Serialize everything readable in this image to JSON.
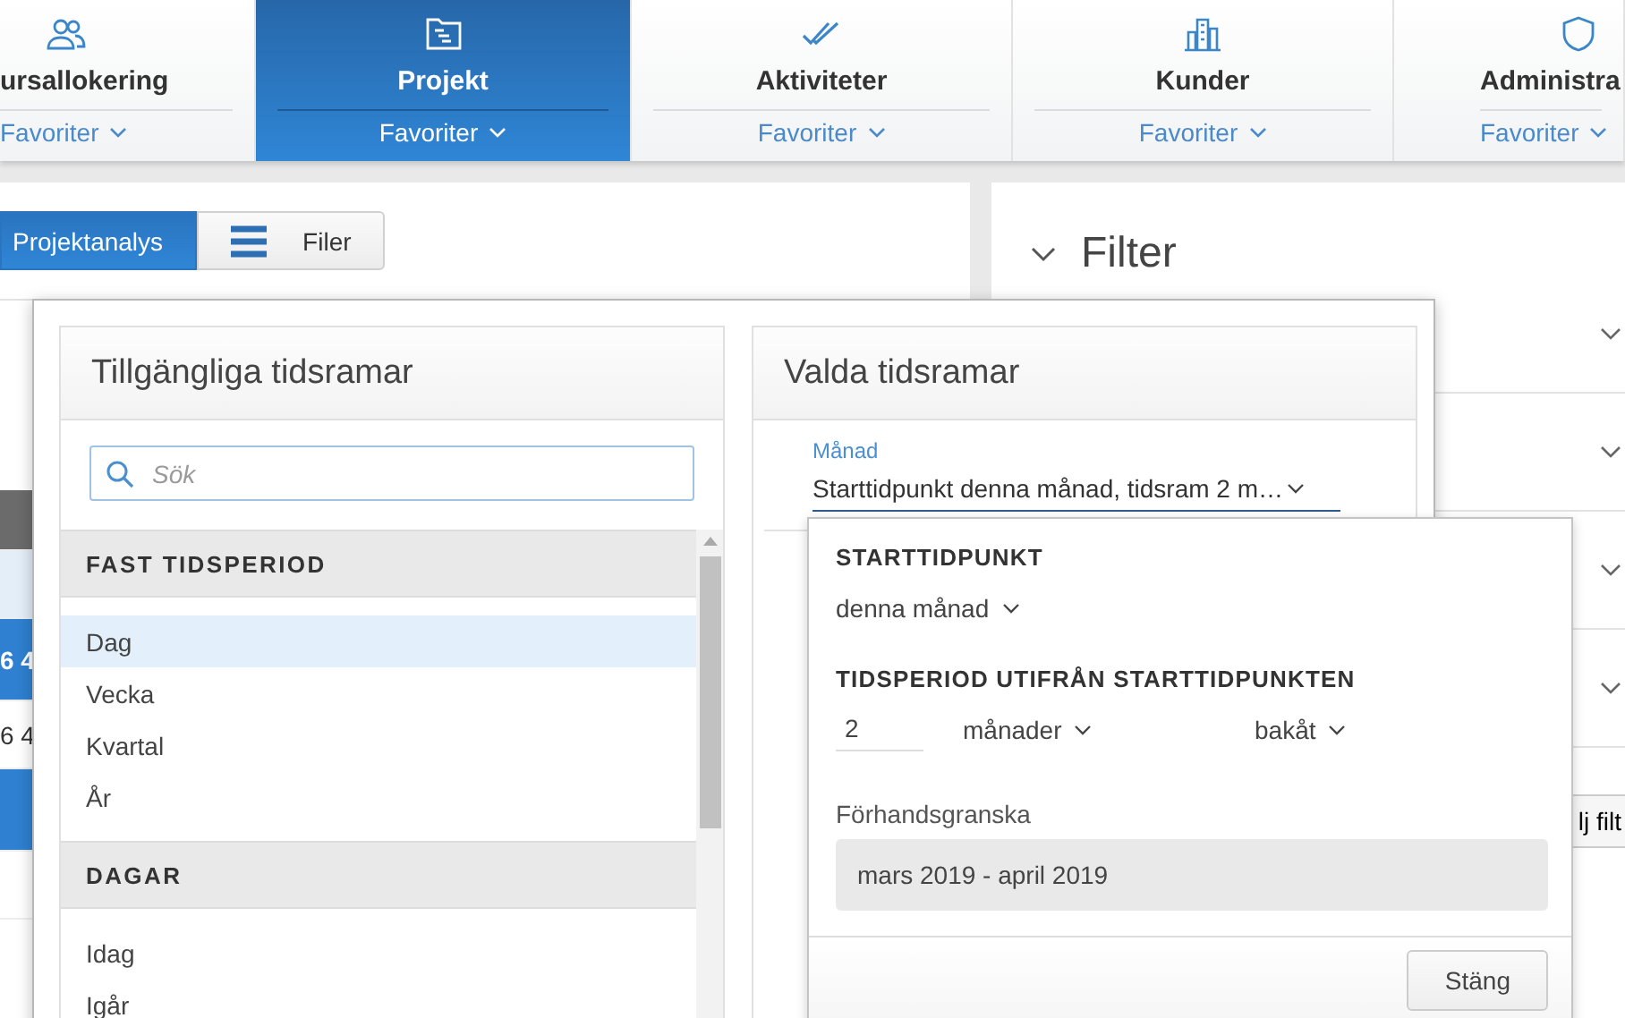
{
  "nav_tabs": [
    {
      "label": "ursallokering",
      "favorites": "Favoriter",
      "selected": false
    },
    {
      "label": "Projekt",
      "favorites": "Favoriter",
      "selected": true
    },
    {
      "label": "Aktiviteter",
      "favorites": "Favoriter",
      "selected": false
    },
    {
      "label": "Kunder",
      "favorites": "Favoriter",
      "selected": false
    },
    {
      "label": "Administra",
      "favorites": "Favoriter",
      "selected": false
    }
  ],
  "toolbar": [
    {
      "label": "Projektanalys",
      "selected": true
    },
    {
      "label": "Filer",
      "selected": false
    }
  ],
  "table_rows": [
    {
      "kind": "header"
    },
    {
      "kind": "hover"
    },
    {
      "kind": "row",
      "cell": "6 4",
      "selected": true
    },
    {
      "kind": "row",
      "cell": "6 4",
      "selected": false
    },
    {
      "kind": "row",
      "selected": true
    },
    {
      "kind": "row",
      "selected": false
    }
  ],
  "filter_panel": {
    "title": "Filter",
    "expanded": true,
    "rows": [
      {
        "expanded": false
      },
      {
        "expanded": false
      },
      {
        "expanded": false
      },
      {
        "expanded": false
      }
    ],
    "button": "lj filt"
  },
  "dialog": {
    "available": {
      "title": "Tillgängliga tidsramar",
      "search": {
        "placeholder": "Sök"
      },
      "groups": [
        {
          "title": "FAST TIDSPERIOD",
          "items": [
            {
              "label": "Dag",
              "selected": true
            },
            {
              "label": "Vecka",
              "selected": false
            },
            {
              "label": "Kvartal",
              "selected": false
            },
            {
              "label": "År",
              "selected": false
            }
          ]
        },
        {
          "title": "DAGAR",
          "items": [
            {
              "label": "Idag",
              "selected": false
            },
            {
              "label": "Igår",
              "selected": false
            }
          ]
        }
      ]
    },
    "chosen": {
      "title": "Valda tidsramar",
      "field_label": "Månad",
      "field_value": "Starttidpunkt denna månad, tidsram 2 m…"
    }
  },
  "popover": {
    "start_heading": "STARTTIDPUNKT",
    "start_value": "denna månad",
    "period_heading": "TIDSPERIOD UTIFRÅN STARTTIDPUNKTEN",
    "count": "2",
    "unit": "månader",
    "direction": "bakåt",
    "preview_label": "Förhandsgranska",
    "preview": "mars 2019 - april 2019",
    "close": "Stäng"
  }
}
